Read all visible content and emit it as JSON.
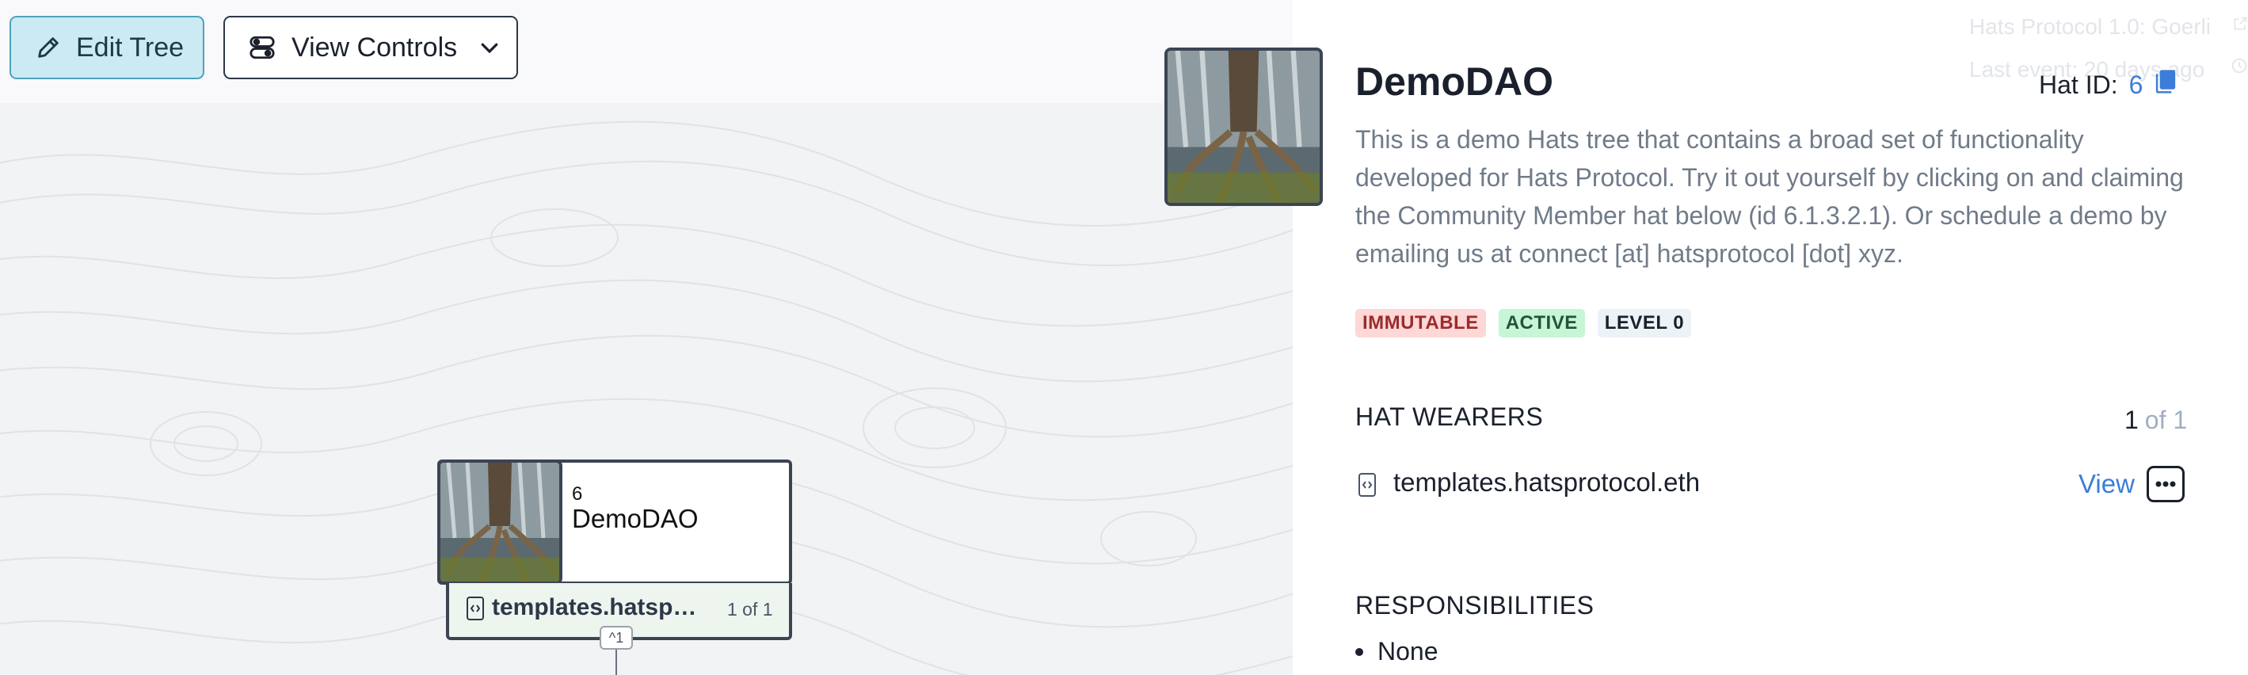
{
  "toolbar": {
    "edit_tree_label": "Edit Tree",
    "view_controls_label": "View Controls"
  },
  "tree_node": {
    "hat_id": "6",
    "name": "DemoDAO",
    "wearer": "templates.hatsp…",
    "wearer_count": "1 of 1",
    "children_toggle": "^1",
    "image_icon": "tree-roots-waterfall-image"
  },
  "panel": {
    "faded_network": "Hats Protocol 1.0: Goerli",
    "faded_last_event": "Last event: 20 days ago",
    "title": "DemoDAO",
    "hat_id_label": "Hat ID:",
    "hat_id_value": "6",
    "description": "This is a demo Hats tree that contains a broad set of functionality developed for Hats Protocol. Try it out yourself by clicking on and claiming the Community Member hat below (id 6.1.3.2.1). Or schedule a demo by emailing us at connect [at] hatsprotocol [dot] xyz.",
    "badges": {
      "immutable": "IMMUTABLE",
      "active": "ACTIVE",
      "level": "LEVEL 0"
    },
    "wearers_title": "HAT WEARERS",
    "wearers_count_current": "1",
    "wearers_count_max": "of 1",
    "wearers": [
      {
        "name": "templates.hatsprotocol.eth",
        "view_label": "View"
      }
    ],
    "responsibilities_title": "RESPONSIBILITIES",
    "responsibilities": [
      "None"
    ]
  },
  "colors": {
    "accent_blue": "#3b7dd8",
    "edit_button_bg": "#cbeaf4",
    "immutable_bg": "#fed7d7",
    "active_bg": "#c6f6d5",
    "canvas_bg": "#f2f3f5"
  }
}
